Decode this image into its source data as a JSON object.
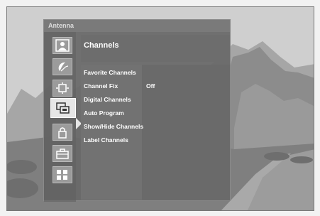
{
  "osd": {
    "header": "Antenna",
    "menu_title": "Channels",
    "icons": [
      {
        "name": "picture-icon"
      },
      {
        "name": "sound-icon"
      },
      {
        "name": "screen-icon"
      },
      {
        "name": "channels-icon",
        "selected": true
      },
      {
        "name": "lock-icon"
      },
      {
        "name": "setup-icon"
      },
      {
        "name": "applications-icon"
      }
    ],
    "items": [
      {
        "label": "Favorite Channels",
        "value": ""
      },
      {
        "label": "Channel Fix",
        "value": "Off"
      },
      {
        "label": "Digital Channels",
        "value": ""
      },
      {
        "label": "Auto Program",
        "value": ""
      },
      {
        "label": "Show/Hide Channels",
        "value": ""
      },
      {
        "label": "Label Channels",
        "value": ""
      }
    ]
  }
}
